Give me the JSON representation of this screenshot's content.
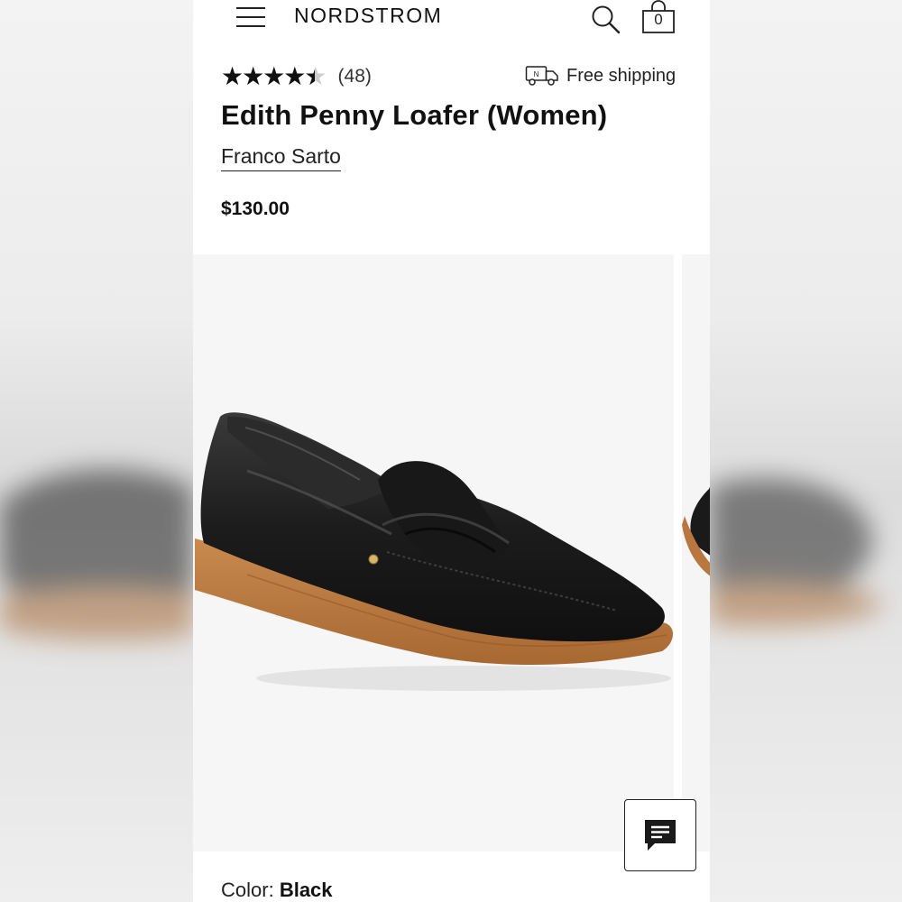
{
  "header": {
    "logo": "NORDSTROM",
    "menu_icon": "hamburger-menu-icon",
    "search_icon": "search-icon",
    "bag_icon": "shopping-bag-icon",
    "bag_count": "0"
  },
  "product": {
    "rating": 4.5,
    "stars_max": 5,
    "reviews_count": "(48)",
    "shipping_label": "Free shipping",
    "shipping_icon": "delivery-truck-icon",
    "title": "Edith Penny Loafer (Women)",
    "brand": "Franco Sarto",
    "price": "$130.00",
    "color_label": "Color:",
    "color_value": "Black"
  },
  "chat": {
    "icon": "chat-bubble-icon"
  },
  "colors": {
    "leather": "#1b1b1b",
    "sole": "#b8773f",
    "text": "#111111"
  }
}
